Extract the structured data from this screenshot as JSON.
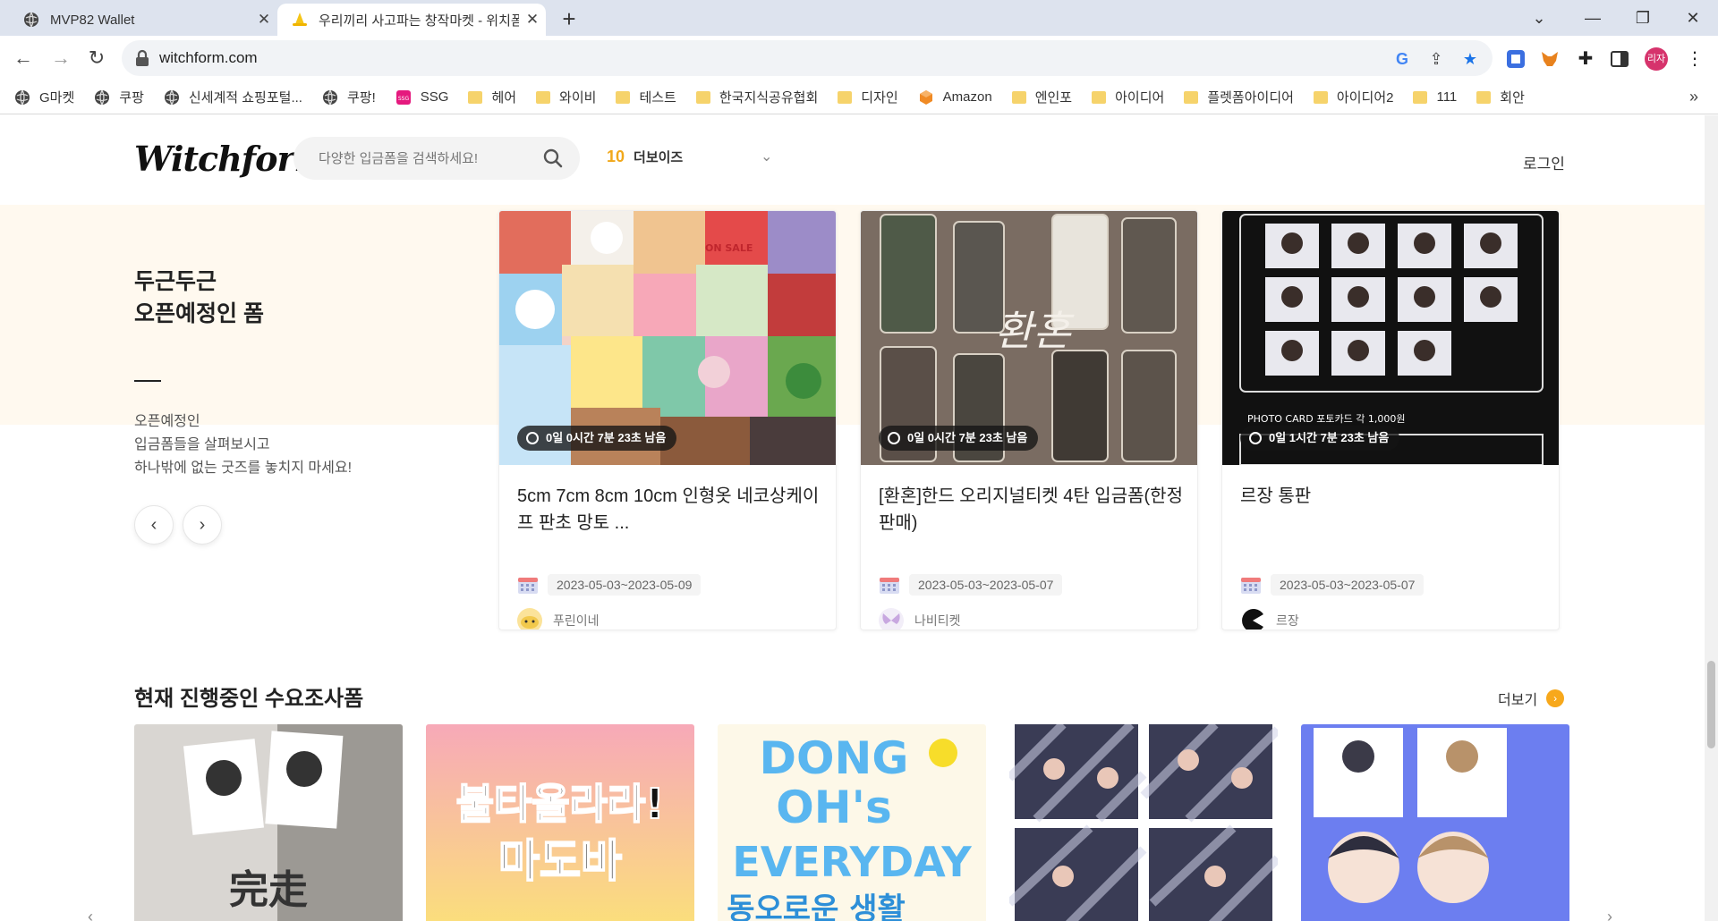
{
  "browser": {
    "tabs": [
      {
        "title": "MVP82 Wallet",
        "active": false
      },
      {
        "title": "우리끼리 사고파는 창작마켓 - 위치폼",
        "active": true
      }
    ],
    "url": "witchform.com",
    "profile_label": "리자",
    "bookmarks": [
      {
        "label": "G마켓",
        "icon": "globe-icon"
      },
      {
        "label": "쿠팡",
        "icon": "globe-icon"
      },
      {
        "label": "신세계적 쇼핑포털...",
        "icon": "globe-icon"
      },
      {
        "label": "쿠팡!",
        "icon": "globe-icon"
      },
      {
        "label": "SSG",
        "icon": "ssg-icon"
      },
      {
        "label": "헤어",
        "icon": "folder-icon"
      },
      {
        "label": "와이비",
        "icon": "folder-icon"
      },
      {
        "label": "테스트",
        "icon": "folder-icon"
      },
      {
        "label": "한국지식공유협회",
        "icon": "folder-icon"
      },
      {
        "label": "디자인",
        "icon": "folder-icon"
      },
      {
        "label": "Amazon",
        "icon": "amazon-icon"
      },
      {
        "label": "엔인포",
        "icon": "folder-icon"
      },
      {
        "label": "아이디어",
        "icon": "folder-icon"
      },
      {
        "label": "플렛폼아이디어",
        "icon": "folder-icon"
      },
      {
        "label": "아이디어2",
        "icon": "folder-icon"
      },
      {
        "label": "111",
        "icon": "folder-icon"
      },
      {
        "label": "회안",
        "icon": "folder-icon"
      }
    ]
  },
  "header": {
    "logo": "Witchform",
    "search_placeholder": "다양한 입금폼을 검색하세요!",
    "rank_number": "10",
    "rank_name": "더보이즈",
    "login": "로그인"
  },
  "promo": {
    "title_line1": "두근두근",
    "title_line2": "오픈예정인 폼",
    "desc_line1": "오픈예정인",
    "desc_line2": "입금폼들을 살펴보시고",
    "desc_line3": "하나밖에 없는 굿즈를 놓치지 마세요!"
  },
  "cards": [
    {
      "timer": "0일 0시간 7분 23초 남음",
      "title": "5cm 7cm 8cm 10cm 인형옷 네코상케이프 판초 망토 ...",
      "date": "2023-05-03~2023-05-09",
      "seller": "푸린이네"
    },
    {
      "timer": "0일 0시간 7분 23초 남음",
      "title": "[환혼]한드 오리지널티켓 4탄 입금폼(한정판매)",
      "date": "2023-05-03~2023-05-07",
      "seller": "나비티켓"
    },
    {
      "timer": "0일 1시간 7분 23초 남음",
      "title": "르장 통판",
      "date": "2023-05-03~2023-05-07",
      "seller": "르장"
    }
  ],
  "section2": {
    "title": "현재 진행중인 수요조사폼",
    "more": "더보기"
  },
  "thumb_text": {
    "card1_sale": "ON SALE",
    "card2_calligraphy": "환혼",
    "card3_caption": "PHOTO CARD 포토카드 각 1,000원",
    "d1_text": "完走",
    "d2_line1": "불타올라라!",
    "d2_line2": "마도바",
    "d3_line1": "DONG",
    "d3_line2": "OH's",
    "d3_line3": "EVERYDAY",
    "d3_line4": "동오로운 생활"
  }
}
